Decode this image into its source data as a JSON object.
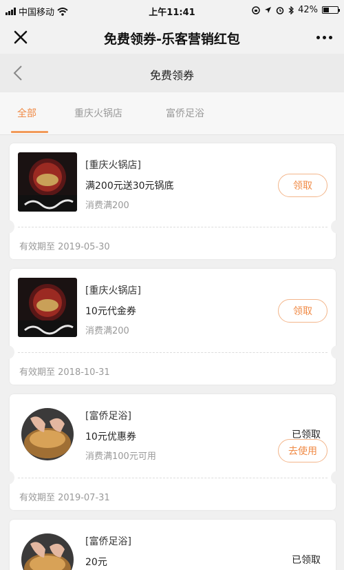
{
  "status_bar": {
    "carrier": "中国移动",
    "time": "上午11:41",
    "battery": "42%",
    "battery_level": 0.42
  },
  "header": {
    "title": "免费领券-乐客营销红包"
  },
  "nav": {
    "title": "免费领券"
  },
  "tabs": [
    {
      "label": "全部",
      "active": true
    },
    {
      "label": "重庆火锅店",
      "active": false
    },
    {
      "label": "富侨足浴",
      "active": false
    }
  ],
  "coupons": [
    {
      "shop": "[重庆火锅店]",
      "desc": "满200元送30元锅底",
      "cond": "消费满200",
      "action": "领取",
      "validity": "有效期至 2019-05-30",
      "image": "hotpot"
    },
    {
      "shop": "[重庆火锅店]",
      "desc": "10元代金券",
      "cond": "消费满200",
      "action": "领取",
      "validity": "有效期至 2018-10-31",
      "image": "hotpot"
    },
    {
      "shop": "[富侨足浴]",
      "desc": "10元优惠券",
      "cond": "消费满100元可用",
      "status": "已领取",
      "action": "去使用",
      "validity": "有效期至 2019-07-31",
      "image": "footbath"
    },
    {
      "shop": "[富侨足浴]",
      "desc": "20元",
      "status": "已领取",
      "image": "footbath"
    }
  ],
  "colors": {
    "accent": "#f08a45",
    "accent_border": "#f3b58a"
  },
  "icons": [
    "signal-icon",
    "wifi-icon",
    "lock-rotation-icon",
    "location-icon",
    "alarm-icon",
    "bluetooth-icon",
    "battery-icon",
    "close-icon",
    "more-icon",
    "back-icon"
  ]
}
